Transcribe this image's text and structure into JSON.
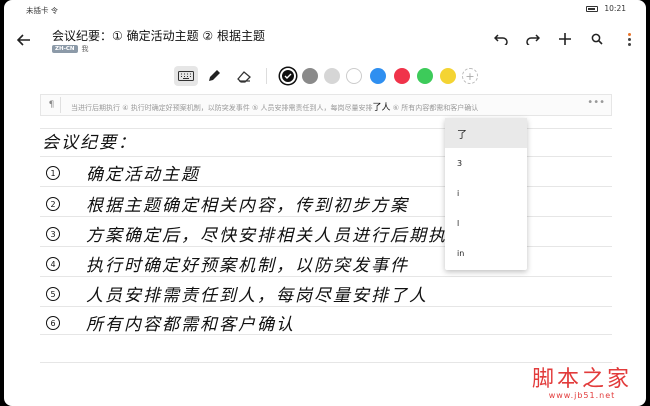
{
  "status": {
    "carrier": "未插卡",
    "wifi": "令",
    "time": "10:21"
  },
  "header": {
    "title": "会议纪要：① 确定活动主题 ② 根据主题",
    "lang_tag": "ZH-CN",
    "author": "我"
  },
  "toolbar_icons": [
    "back-arrow-icon",
    "undo-icon",
    "redo-icon",
    "plus-icon",
    "search-icon",
    "more-icon"
  ],
  "pen_colors": [
    "#111111",
    "#8a8a8a",
    "#d6d6d6",
    "#ffffff",
    "#2f8ff0",
    "#f0334a",
    "#3dcb5a",
    "#f4d433"
  ],
  "recognition": {
    "text_before": "当进行后期执行 ④ 执行时确定好预案机制，以防突发事件 ⑤ 人员安排需责任到人，每岗尽量安排",
    "highlight": "了人",
    "text_after": " ⑥ 所有内容都需和客户确认",
    "more": "•••"
  },
  "candidates": [
    "了",
    "3",
    "i",
    "l",
    "in"
  ],
  "notes": {
    "heading": "会议纪要：",
    "items": [
      {
        "num": "1",
        "text": "确定活动主题"
      },
      {
        "num": "2",
        "text": "根据主题确定相关内容，传到初步方案"
      },
      {
        "num": "3",
        "text": "方案确定后，尽快安排相关人员进行后期执行"
      },
      {
        "num": "4",
        "text": "执行时确定好预案机制，以防突发事件"
      },
      {
        "num": "5",
        "text": "人员安排需责任到人，每岗尽量安排了人"
      },
      {
        "num": "6",
        "text": "所有内容都需和客户确认"
      }
    ]
  },
  "watermark": {
    "title": "脚本之家",
    "url": "www.jb51.net"
  }
}
